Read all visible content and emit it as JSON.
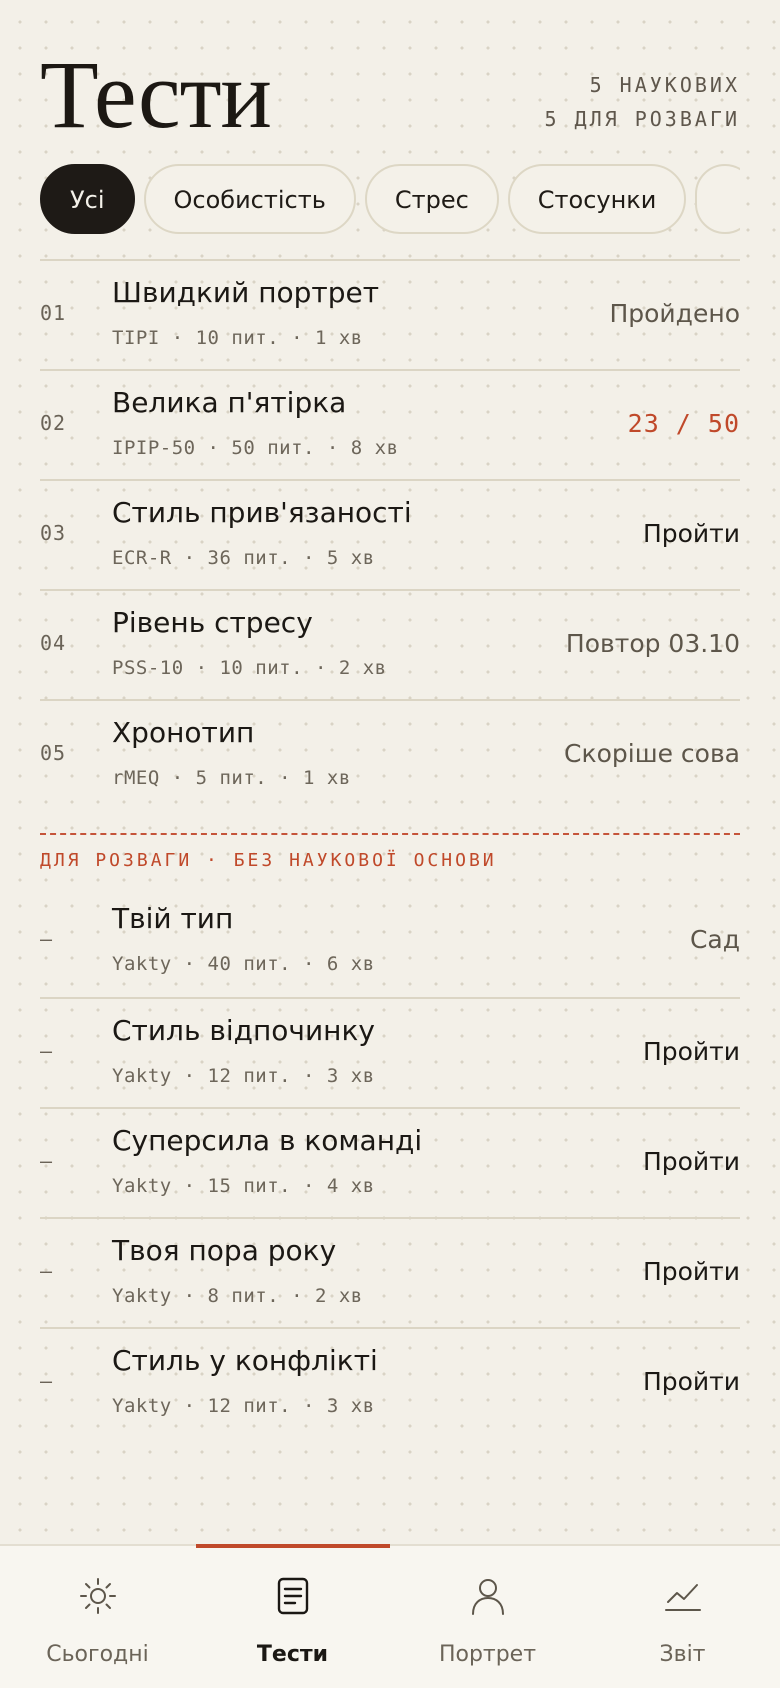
{
  "header": {
    "title": "Тести",
    "count_scientific": "5 наукових",
    "count_fun": "5 для розваги"
  },
  "filters": [
    {
      "label": "Усі",
      "active": true
    },
    {
      "label": "Особистість",
      "active": false
    },
    {
      "label": "Стрес",
      "active": false
    },
    {
      "label": "Стосунки",
      "active": false
    },
    {
      "label": "",
      "active": false
    }
  ],
  "scientific_tests": [
    {
      "num": "01",
      "title": "Швидкий портрет",
      "meta": "TIPI · 10 пит. · 1 хв",
      "status": "Пройдено",
      "status_kind": "done"
    },
    {
      "num": "02",
      "title": "Велика п'ятірка",
      "meta": "IPIP-50 · 50 пит. · 8 хв",
      "status": "23 / 50",
      "status_kind": "progress"
    },
    {
      "num": "03",
      "title": "Стиль прив'язаності",
      "meta": "ECR-R · 36 пит. · 5 хв",
      "status": "Пройти",
      "status_kind": "action"
    },
    {
      "num": "04",
      "title": "Рівень стресу",
      "meta": "PSS-10 · 10 пит. · 2 хв",
      "status": "Повтор 03.10",
      "status_kind": "done"
    },
    {
      "num": "05",
      "title": "Хронотип",
      "meta": "rMEQ · 5 пит. · 1 хв",
      "status": "Скоріше сова",
      "status_kind": "done"
    }
  ],
  "fun_section_label": "Для розваги · без наукової основи",
  "fun_tests": [
    {
      "num": "—",
      "title": "Твій тип",
      "meta": "Yakty · 40 пит. · 6 хв",
      "status": "Сад",
      "status_kind": "done"
    },
    {
      "num": "—",
      "title": "Стиль відпочинку",
      "meta": "Yakty · 12 пит. · 3 хв",
      "status": "Пройти",
      "status_kind": "action"
    },
    {
      "num": "—",
      "title": "Суперсила в команді",
      "meta": "Yakty · 15 пит. · 4 хв",
      "status": "Пройти",
      "status_kind": "action"
    },
    {
      "num": "—",
      "title": "Твоя пора року",
      "meta": "Yakty · 8 пит. · 2 хв",
      "status": "Пройти",
      "status_kind": "action"
    },
    {
      "num": "—",
      "title": "Стиль у конфлікті",
      "meta": "Yakty · 12 пит. · 3 хв",
      "status": "Пройти",
      "status_kind": "action"
    }
  ],
  "tabbar": [
    {
      "label": "Сьогодні",
      "icon": "sun-icon",
      "active": false
    },
    {
      "label": "Тести",
      "icon": "document-icon",
      "active": true
    },
    {
      "label": "Портрет",
      "icon": "person-icon",
      "active": false
    },
    {
      "label": "Звіт",
      "icon": "chart-icon",
      "active": false
    }
  ],
  "colors": {
    "background": "#f3f0e8",
    "accent": "#c0492a",
    "ink": "#1b1814",
    "muted": "#6d665a"
  }
}
